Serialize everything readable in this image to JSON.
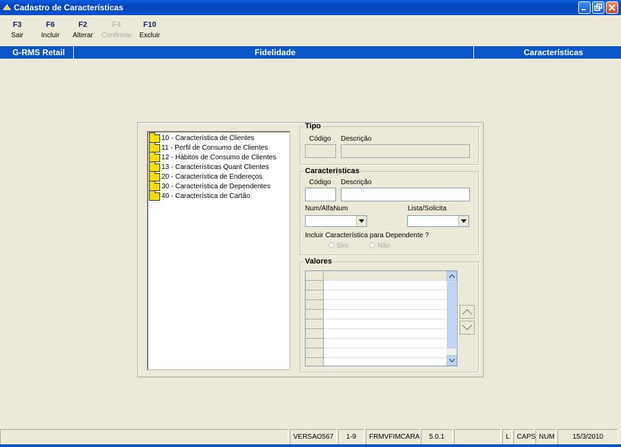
{
  "window": {
    "title": "Cadastro de Características"
  },
  "toolbar": {
    "buttons": [
      {
        "key": "F3",
        "label": "Sair",
        "enabled": true
      },
      {
        "key": "F6",
        "label": "Incluir",
        "enabled": true
      },
      {
        "key": "F2",
        "label": "Alterar",
        "enabled": true
      },
      {
        "key": "F4",
        "label": "Confirmar",
        "enabled": false
      },
      {
        "key": "F10",
        "label": "Excluir",
        "enabled": true
      }
    ]
  },
  "header": {
    "app": "G-RMS Retail",
    "module": "Fidelidade",
    "screen": "Características"
  },
  "tree": {
    "items": [
      "10 - Característica de Clientes",
      "11 - Perfil de Consumo de Clientes",
      "12 - Hábitos de Consumo de Clientes",
      "13 - Características Quant Clientes",
      "20 - Característica de Endereços",
      "30 - Característica de Dependentes",
      "40 - Característica de Cartão"
    ]
  },
  "tipo": {
    "legend": "Tipo",
    "codigo_label": "Código",
    "descricao_label": "Descrição",
    "codigo_value": "",
    "descricao_value": ""
  },
  "caracteristicas": {
    "legend": "Características",
    "codigo_label": "Código",
    "descricao_label": "Descrição",
    "codigo_value": "",
    "descricao_value": "",
    "num_alfa_label": "Num/AlfaNum",
    "num_alfa_value": "",
    "lista_label": "Lista/Solicita",
    "lista_value": "",
    "dependente_question": "Incluir Característica para Dependente ?",
    "radio_sim": "Sim",
    "radio_nao": "Não"
  },
  "valores": {
    "legend": "Valores",
    "row_count": 9
  },
  "statusbar": {
    "cells": [
      "VERSAO567",
      "1-9",
      "FRMVFIMCARA",
      "5.0.1",
      "L",
      "CAPS",
      "NUM",
      "15/3/2010"
    ]
  },
  "colors": {
    "accent": "#0a55c8",
    "background": "#ece9d8",
    "folder": "#f7e000"
  }
}
